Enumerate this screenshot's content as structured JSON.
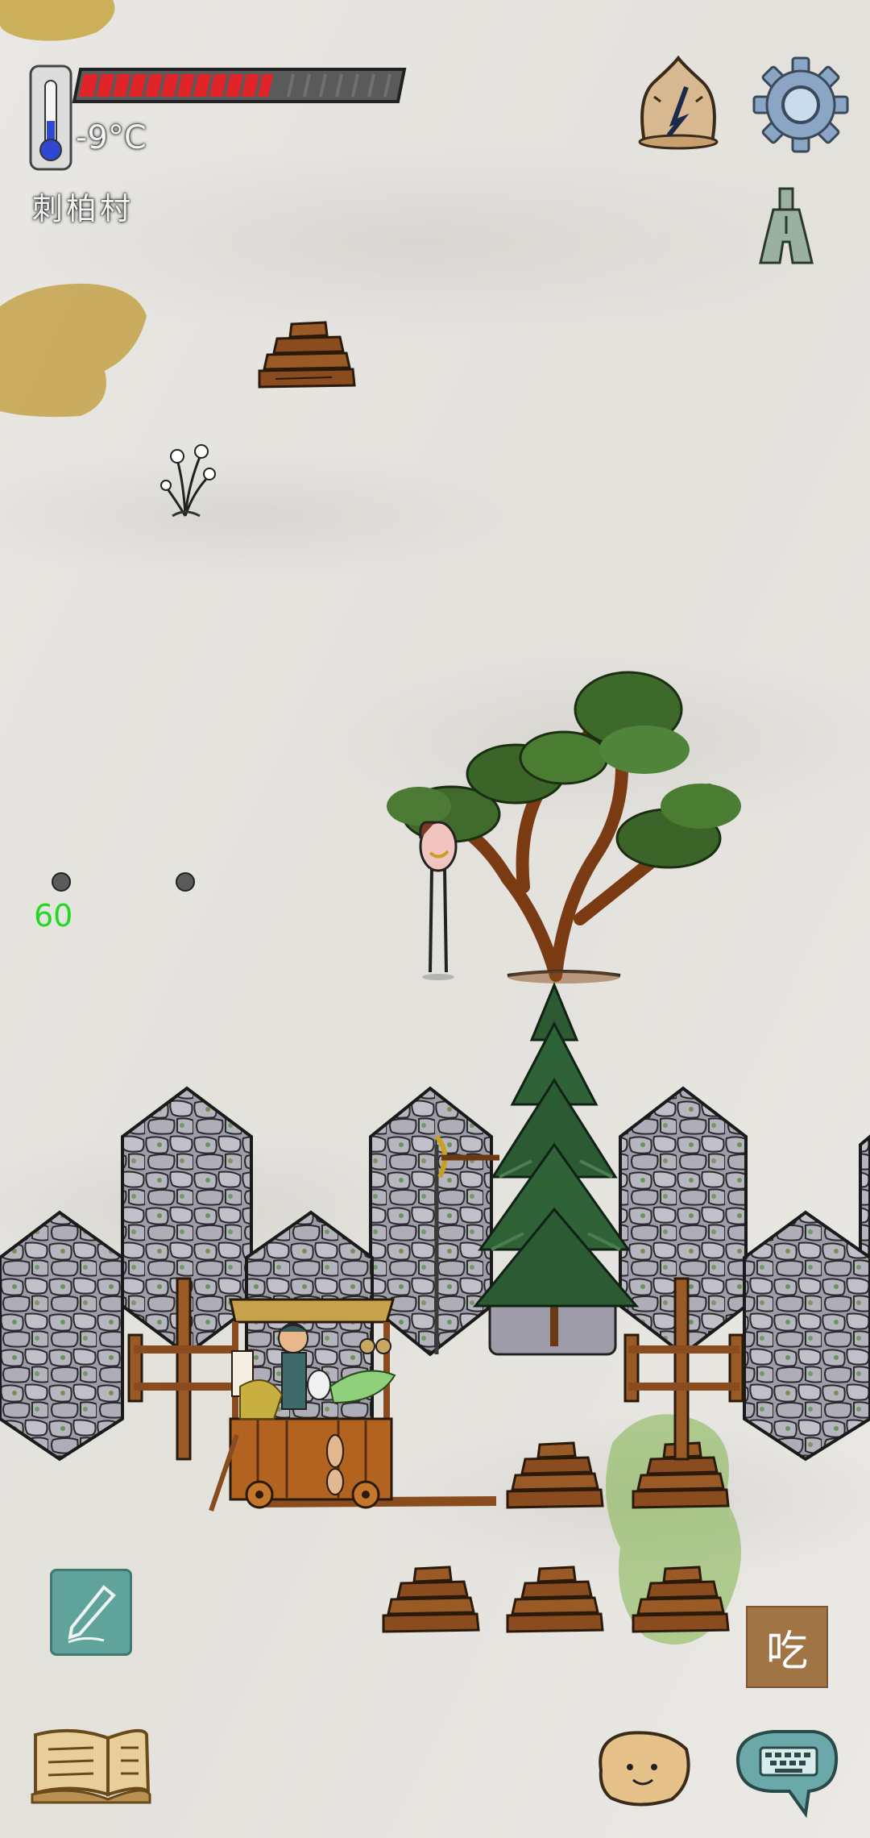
{
  "hud": {
    "temperature": "-9°C",
    "location": "刺柏村",
    "health_level": 0.6,
    "health_color": "#e0242a"
  },
  "debug": {
    "fps": "60"
  },
  "buttons": {
    "eat_label": "吃",
    "compass_icon": "compass-icon",
    "settings_icon": "gear-icon",
    "coin_icon": "ancient-coin-icon",
    "note_icon": "pencil-icon",
    "book_icon": "open-book-icon",
    "emote_icon": "smiley-face-icon",
    "keyboard_icon": "keyboard-chat-icon"
  },
  "colors": {
    "paper_bg": "#e6e4df",
    "stone": "#a3a3ae",
    "moss": "#5a8a3a",
    "wood": "#8a4c1e",
    "eat_button": "#a07444",
    "fps_text": "#22d822"
  }
}
